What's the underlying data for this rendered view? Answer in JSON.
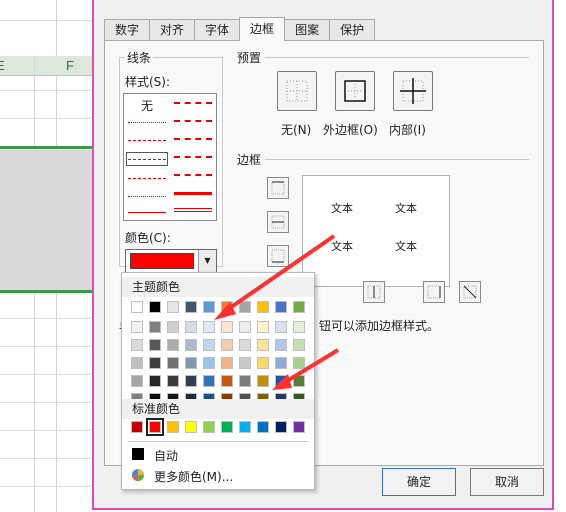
{
  "sheet": {
    "columns": [
      "E",
      "F"
    ]
  },
  "dialog": {
    "tabs": [
      {
        "label": "数字"
      },
      {
        "label": "对齐"
      },
      {
        "label": "字体"
      },
      {
        "label": "边框",
        "active": true
      },
      {
        "label": "图案"
      },
      {
        "label": "保护"
      }
    ],
    "lines_group": "线条",
    "style_label": "样式(S):",
    "style_none": "无",
    "color_label": "颜色(C):",
    "selected_color": "#ff0000",
    "presets_group": "预置",
    "presets": [
      {
        "label": "无(N)"
      },
      {
        "label": "外边框(O)"
      },
      {
        "label": "内部(I)"
      }
    ],
    "border_group": "边框",
    "preview_text": [
      "文本",
      "文本",
      "文本",
      "文本"
    ],
    "hint_prefix": "单",
    "hint_suffix": "钮可以添加边框样式。",
    "ok": "确定",
    "cancel": "取消"
  },
  "color_dropdown": {
    "theme_title": "主题颜色",
    "theme_top": [
      "#ffffff",
      "#000000",
      "#e7e6e6",
      "#44546a",
      "#5b9bd5",
      "#ed7d31",
      "#a5a5a5",
      "#ffc000",
      "#4472c4",
      "#70ad47"
    ],
    "theme_shades": [
      [
        "#f2f2f2",
        "#7f7f7f",
        "#d0cece",
        "#d6dce4",
        "#deebf6",
        "#fbe5d5",
        "#ededed",
        "#fff2cc",
        "#d9e2f3",
        "#e2efd9"
      ],
      [
        "#d9d9d9",
        "#595959",
        "#aeabab",
        "#adb9ca",
        "#bdd7ee",
        "#f7cbac",
        "#dbdbdb",
        "#fee599",
        "#b4c6e7",
        "#c5e0b3"
      ],
      [
        "#bfbfbf",
        "#3f3f3f",
        "#757070",
        "#8496b0",
        "#9cc3e5",
        "#f4b183",
        "#c9c9c9",
        "#ffd965",
        "#8eaadb",
        "#a8d08d"
      ],
      [
        "#a5a5a5",
        "#262626",
        "#3a3838",
        "#323f4f",
        "#2e75b5",
        "#c55a11",
        "#7b7b7b",
        "#bf9000",
        "#2f5496",
        "#538135"
      ],
      [
        "#7f7f7f",
        "#0c0c0c",
        "#171616",
        "#222a35",
        "#1e4e79",
        "#843c0b",
        "#525252",
        "#7f6000",
        "#1f3864",
        "#375623"
      ]
    ],
    "standard_title": "标准颜色",
    "standard": [
      "#c00000",
      "#ff0000",
      "#ffc000",
      "#ffff00",
      "#92d050",
      "#00b050",
      "#00b0f0",
      "#0070c0",
      "#002060",
      "#7030a0"
    ],
    "selected_standard_index": 1,
    "auto_label": "自动",
    "auto_color": "#000000",
    "more_label": "更多颜色(M)...",
    "more_icon": "color-wheel-icon"
  },
  "annotation_color": "#ff3030",
  "dialog_border_color": "#e04bb5"
}
